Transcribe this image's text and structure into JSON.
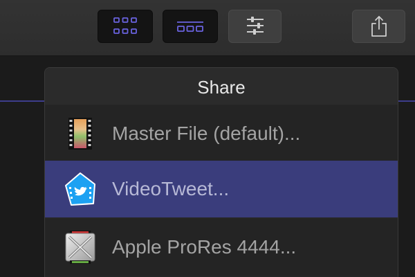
{
  "toolbar": {
    "buttons": [
      {
        "name": "grid-view",
        "icon": "grid-icon",
        "active": true
      },
      {
        "name": "filmstrip-view",
        "icon": "filmstrip-icon",
        "active": true
      },
      {
        "name": "inspector",
        "icon": "sliders-icon",
        "active": false
      },
      {
        "name": "share",
        "icon": "share-icon",
        "active": false
      }
    ],
    "accent_color": "#6a63e0"
  },
  "share_popover": {
    "title": "Share",
    "items": [
      {
        "label": "Master File (default)...",
        "icon": "film-strip-icon",
        "selected": false
      },
      {
        "label": "VideoTweet...",
        "icon": "twitter-house-icon",
        "selected": true
      },
      {
        "label": "Apple ProRes 4444...",
        "icon": "prores-icon",
        "selected": false
      }
    ],
    "selection_color": "#3a3d7c"
  }
}
